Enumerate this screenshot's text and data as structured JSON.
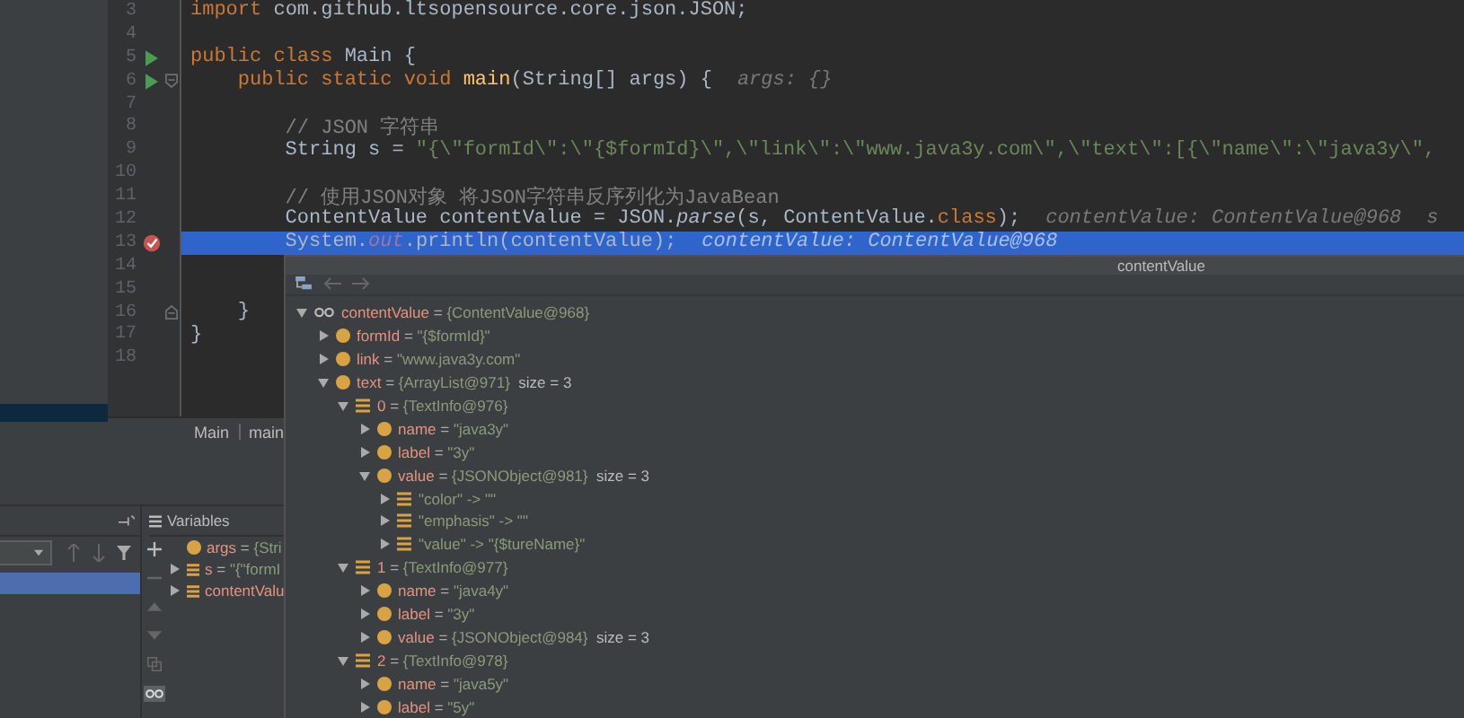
{
  "editor": {
    "lines": [
      {
        "number": "3",
        "segments": [
          {
            "kind": "keyword",
            "text": "import "
          },
          {
            "kind": "plain",
            "text": "com.github.ltsopensource.core.json.JSON;"
          }
        ]
      },
      {
        "number": "4"
      },
      {
        "number": "5",
        "run": true,
        "segments": [
          {
            "kind": "keyword",
            "text": "public class "
          },
          {
            "kind": "plain",
            "text": "Main {"
          }
        ]
      },
      {
        "number": "6",
        "run": true,
        "fold_start": true,
        "segments": [
          {
            "kind": "keyword",
            "text": "    public static void "
          },
          {
            "kind": "method",
            "text": "main"
          },
          {
            "kind": "plain",
            "text": "(String[] args) {"
          }
        ],
        "hints": [
          "args: {}"
        ]
      },
      {
        "number": "7"
      },
      {
        "number": "8",
        "segments": [
          {
            "kind": "comment",
            "text": "        // JSON 字符串"
          }
        ]
      },
      {
        "number": "9",
        "segments": [
          {
            "kind": "plain",
            "text": "        String s = "
          },
          {
            "kind": "string",
            "text": "\"{\\\"formId\\\":\\\"{$formId}\\\",\\\"link\\\":\\\"www.java3y.com\\\",\\\"text\\\":[{\\\"name\\\":\\\"java3y\\\","
          }
        ]
      },
      {
        "number": "10"
      },
      {
        "number": "11",
        "segments": [
          {
            "kind": "comment",
            "text": "        // 使用JSON对象 将JSON字符串反序列化为JavaBean"
          }
        ]
      },
      {
        "number": "12",
        "segments": [
          {
            "kind": "plain",
            "text": "        ContentValue contentValue = JSON."
          },
          {
            "kind": "static-method",
            "text": "parse"
          },
          {
            "kind": "plain",
            "text": "(s, ContentValue."
          },
          {
            "kind": "keyword",
            "text": "class"
          },
          {
            "kind": "plain",
            "text": ");"
          }
        ],
        "hints": [
          "contentValue: ContentValue@968",
          "s"
        ]
      },
      {
        "number": "13",
        "breakpoint": true,
        "current": true,
        "segments": [
          {
            "kind": "plain",
            "text": "        System."
          },
          {
            "kind": "field",
            "text": "out"
          },
          {
            "kind": "plain",
            "text": ".println(contentValue);"
          }
        ],
        "hints": [
          "contentValue: ContentValue@968"
        ]
      },
      {
        "number": "14"
      },
      {
        "number": "15"
      },
      {
        "number": "16",
        "fold_end": true,
        "segments": [
          {
            "kind": "plain",
            "text": "    }"
          }
        ]
      },
      {
        "number": "17",
        "segments": [
          {
            "kind": "plain",
            "text": "}"
          }
        ]
      },
      {
        "number": "18"
      }
    ],
    "breadcrumbs": [
      "Main",
      "main"
    ]
  },
  "debug": {
    "frames": {
      "selected_frame": true
    },
    "variables_tab": "Variables",
    "variables": [
      {
        "kind": "param",
        "name": "args",
        "operator": "=",
        "value": "{Stri",
        "expandable": false
      },
      {
        "kind": "element",
        "name": "s",
        "operator": "=",
        "value": "\"{\"formI",
        "expandable": true
      },
      {
        "kind": "element",
        "name": "contentValu",
        "expandable": true
      }
    ]
  },
  "popup": {
    "title": "contentValue",
    "tree": [
      {
        "kind": "watch",
        "name": "contentValue",
        "operator": "=",
        "value": "{ContentValue@968}",
        "expanded": true,
        "children": [
          {
            "kind": "field",
            "name": "formId",
            "operator": "=",
            "value": "\"{$formId}\"",
            "expanded": false
          },
          {
            "kind": "field",
            "name": "link",
            "operator": "=",
            "value": "\"www.java3y.com\"",
            "expanded": false
          },
          {
            "kind": "field",
            "name": "text",
            "operator": "=",
            "value": "{ArrayList@971}",
            "extra": "size = 3",
            "expanded": true,
            "children": [
              {
                "kind": "element",
                "name": "0",
                "operator": "=",
                "value": "{TextInfo@976}",
                "expanded": true,
                "children": [
                  {
                    "kind": "field",
                    "name": "name",
                    "operator": "=",
                    "value": "\"java3y\"",
                    "expanded": false
                  },
                  {
                    "kind": "field",
                    "name": "label",
                    "operator": "=",
                    "value": "\"3y\"",
                    "expanded": false
                  },
                  {
                    "kind": "field",
                    "name": "value",
                    "operator": "=",
                    "value": "{JSONObject@981}",
                    "extra": "size = 3",
                    "expanded": true,
                    "children": [
                      {
                        "kind": "entry",
                        "name": "\"color\" -> \"\"",
                        "expanded": false
                      },
                      {
                        "kind": "entry",
                        "name": "\"emphasis\" -> \"\"",
                        "expanded": false
                      },
                      {
                        "kind": "entry",
                        "name": "\"value\" -> \"{$tureName}\"",
                        "expanded": false
                      }
                    ]
                  }
                ]
              },
              {
                "kind": "element",
                "name": "1",
                "operator": "=",
                "value": "{TextInfo@977}",
                "expanded": true,
                "children": [
                  {
                    "kind": "field",
                    "name": "name",
                    "operator": "=",
                    "value": "\"java4y\"",
                    "expanded": false
                  },
                  {
                    "kind": "field",
                    "name": "label",
                    "operator": "=",
                    "value": "\"3y\"",
                    "expanded": false
                  },
                  {
                    "kind": "field",
                    "name": "value",
                    "operator": "=",
                    "value": "{JSONObject@984}",
                    "extra": "size = 3",
                    "expanded": false
                  }
                ]
              },
              {
                "kind": "element",
                "name": "2",
                "operator": "=",
                "value": "{TextInfo@978}",
                "expanded": true,
                "children": [
                  {
                    "kind": "field",
                    "name": "name",
                    "operator": "=",
                    "value": "\"java5y\"",
                    "expanded": false
                  },
                  {
                    "kind": "field",
                    "name": "label",
                    "operator": "=",
                    "value": "\"5y\"",
                    "expanded": false
                  }
                ]
              }
            ]
          }
        ]
      }
    ]
  }
}
